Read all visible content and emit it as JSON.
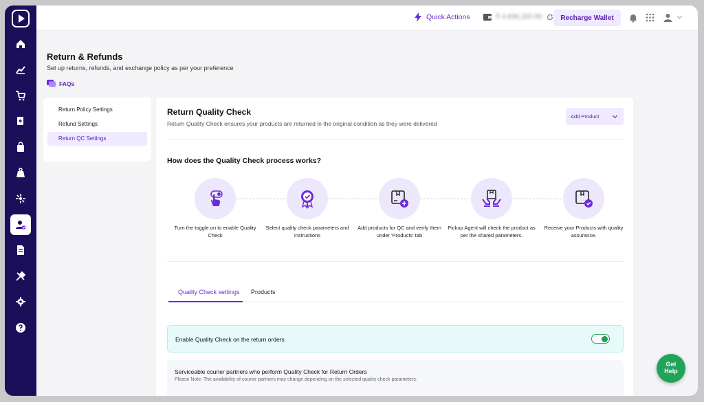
{
  "topbar": {
    "quick_actions": "Quick Actions",
    "wallet_balance": "₹ 4,836,320.99",
    "recharge": "Recharge Wallet"
  },
  "page": {
    "title": "Return & Refunds",
    "subtitle": "Set up returns, refunds, and exchange policy as per your preference",
    "faqs": "FAQs"
  },
  "left_menu": [
    {
      "label": "Return Policy Settings"
    },
    {
      "label": "Refund Settings"
    },
    {
      "label": "Return QC Settings",
      "active": true
    }
  ],
  "card": {
    "title": "Return Quality Check",
    "subtitle": "Return Quality Check ensures your products are returned in the original condition as they were delivered",
    "add_product": "Add Product",
    "how_title": "How does the Quality Check process works?",
    "steps": [
      {
        "text": "Turn the toggle on to enable Quality Check",
        "icon": "tap-toggle-icon"
      },
      {
        "text": "Select quality check parameters and instructions",
        "icon": "badge-check-icon"
      },
      {
        "text": "Add products for QC and verify them under 'Products' tab",
        "icon": "box-add-icon"
      },
      {
        "text": "Pickup Agent will check the product as per the shared parameters.",
        "icon": "hands-box-icon"
      },
      {
        "text": "Receive your Products with quality assurance.",
        "icon": "box-verified-icon"
      }
    ],
    "tabs": [
      {
        "label": "Quality Check settings",
        "active": true
      },
      {
        "label": "Products"
      }
    ],
    "toggle_label": "Enable Quality Check on the return orders",
    "toggle_on": true,
    "courier_title": "Serviceable courier partners who perform Quality Check for Return Orders",
    "courier_note": "Please Note: The availability of courier partners may change depending on the selected quality check parameters."
  },
  "help": {
    "line1": "Get",
    "line2": "Help"
  },
  "colors": {
    "sidebar": "#1c0f5a",
    "accent": "#6c2bd9",
    "toggle": "#1f9d55",
    "help": "#22a35a"
  }
}
